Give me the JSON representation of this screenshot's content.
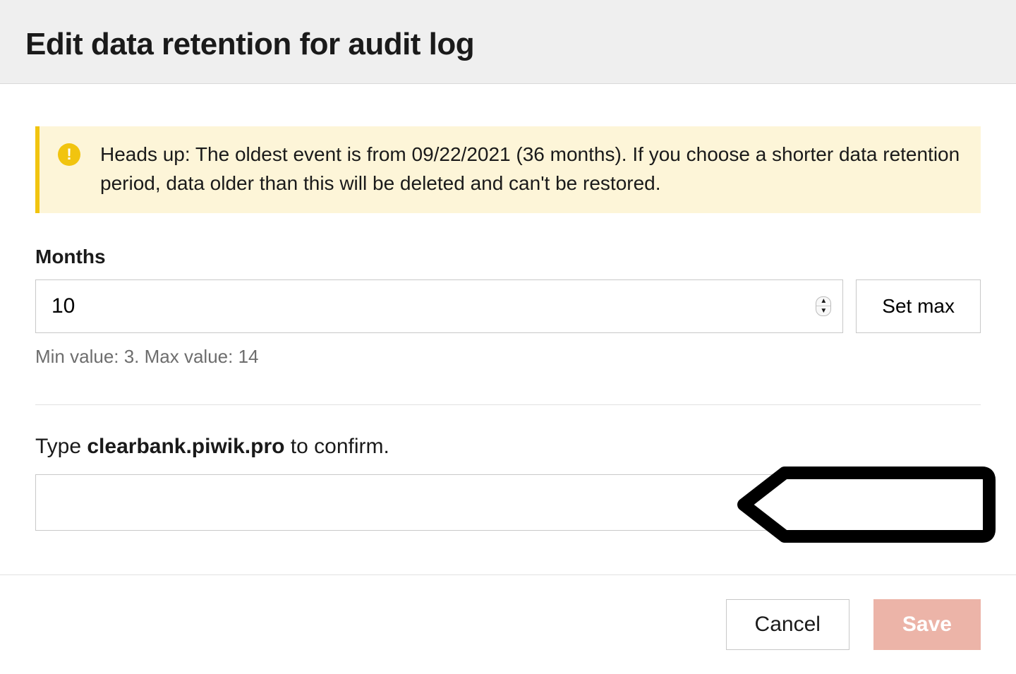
{
  "header": {
    "title": "Edit data retention for audit log"
  },
  "alert": {
    "icon_label": "warning-icon",
    "text": "Heads up: The oldest event is from 09/22/2021 (36 months). If you choose a shorter data retention period, data older than this will be deleted and can't be restored."
  },
  "months": {
    "label": "Months",
    "value": "10",
    "set_max_label": "Set max",
    "hint": "Min value: 3. Max value: 14"
  },
  "confirm": {
    "prefix": "Type ",
    "domain": "clearbank.piwik.pro",
    "suffix": " to confirm.",
    "value": ""
  },
  "footer": {
    "cancel_label": "Cancel",
    "save_label": "Save"
  }
}
